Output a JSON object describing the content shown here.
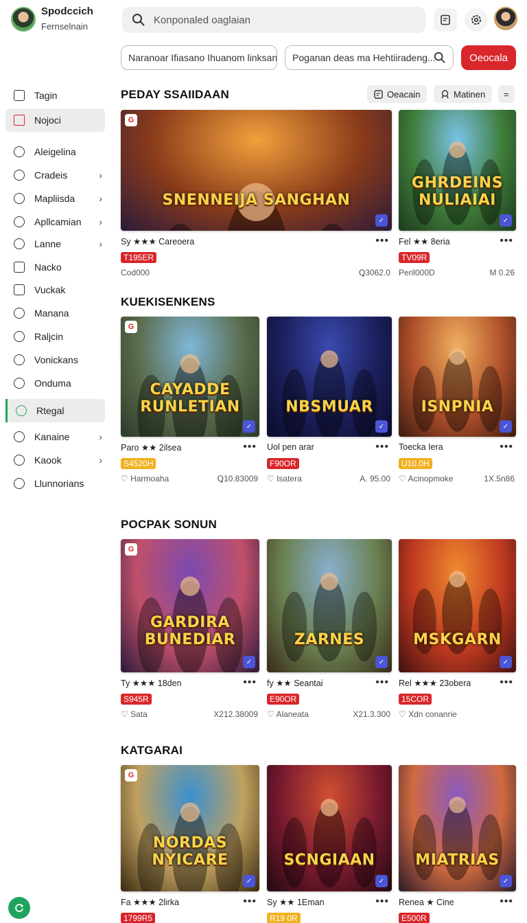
{
  "header": {
    "profile_name": "Spodccich",
    "profile_sub": "Fernselnain",
    "search_placeholder": "Konponaled oaglaian",
    "field1": "Naranoar Ifiasano Ihuanom linksan",
    "field2": "Poganan deas ma Hehtiiradeng...",
    "action_button": "Oeocala",
    "icons": [
      "search-icon",
      "document-icon",
      "settings-icon"
    ]
  },
  "sidebar": {
    "items": [
      {
        "label": "Tagin",
        "chevron": false
      },
      {
        "label": "Nojoci",
        "chevron": false
      },
      {
        "label": "Aleigelina",
        "chevron": false
      },
      {
        "label": "Cradeis",
        "chevron": true
      },
      {
        "label": "Mapliisda",
        "chevron": true
      },
      {
        "label": "Apllcamian",
        "chevron": true
      },
      {
        "label": "Lanne",
        "chevron": true
      },
      {
        "label": "Nacko",
        "chevron": false
      },
      {
        "label": "Vuckak",
        "chevron": false
      },
      {
        "label": "Manana",
        "chevron": false
      },
      {
        "label": "Raljcin",
        "chevron": false
      },
      {
        "label": "Vonickans",
        "chevron": false
      },
      {
        "label": "Onduma",
        "chevron": false
      },
      {
        "label": "Rtegal",
        "chevron": false
      },
      {
        "label": "Kanaine",
        "chevron": true
      },
      {
        "label": "Kaook",
        "chevron": true
      },
      {
        "label": "Llunnorians",
        "chevron": false
      }
    ],
    "active_item": "Nojoci",
    "selected_item": "Rtegal",
    "accent_color": "#1fa35c"
  },
  "sections": [
    {
      "title": "PEDAY SSAIIDAAN",
      "pills": [
        "Oeacain",
        "Matinen",
        "="
      ],
      "cards": [
        {
          "game_title": "SNENNEIJA SANGHAN",
          "meta": "Sy ★★★ Careoera",
          "price": "T195ER",
          "price_color": "red",
          "sub_left": "Cod000",
          "sub_right": "Ꝗ3062.0"
        },
        {
          "game_title": "GHRDEINS NULIAIAI",
          "meta": "Fel ★★ 8eria",
          "price": "TV09R",
          "price_color": "red",
          "sub_left": "Peril000D",
          "sub_right": "M 0.26"
        }
      ]
    },
    {
      "title": "KUEKISENKENS",
      "cards": [
        {
          "game_title": "CAYADDE RUNLETIAN",
          "meta": "Paro ★★ 2ilsea",
          "price": "S4520H",
          "price_color": "yellow",
          "sub_left": "Harmoaha",
          "sub_right": "Ꝗ10.83009"
        },
        {
          "game_title": "NBSMUAR",
          "meta": "Uol pen arar",
          "price": "F90OR",
          "price_color": "red",
          "sub_left": "Isatera",
          "sub_right": "A. 95.00"
        },
        {
          "game_title": "ISNPNIA",
          "meta": "Toecka Iera",
          "price": "U10.0H",
          "price_color": "yellow",
          "sub_left": "Acinopmoke",
          "sub_right": "1X.5n86"
        }
      ]
    },
    {
      "title": "POCPAK SONUN",
      "cards": [
        {
          "game_title": "GARDIRA BUNEDIAR",
          "meta": "Ty ★★★ 18den",
          "price": "S945R",
          "price_color": "red",
          "sub_left": "Sata",
          "sub_right": "X212.38009"
        },
        {
          "game_title": "ZARNES",
          "meta": "fy ★★ Seantai",
          "price": "E90OR",
          "price_color": "red",
          "sub_left": "Alaneata",
          "sub_right": "X21.3.300"
        },
        {
          "game_title": "MSKGARN",
          "meta": "Rel ★★★ 23obera",
          "price": "15COR",
          "price_color": "red",
          "sub_left": "Xdn conanrie",
          "sub_right": ""
        }
      ]
    },
    {
      "title": "KATGARAI",
      "cards": [
        {
          "game_title": "NORDAS NYICARE",
          "meta": "Fa ★★★ 2lirka",
          "price": "1799R5",
          "price_color": "red"
        },
        {
          "game_title": "SCNGIAAN",
          "meta": "Sy ★★ 1Eman",
          "price": "R19 0R",
          "price_color": "yellow"
        },
        {
          "game_title": "MIATRIAS",
          "meta": "Renea ★ Cine",
          "price": "E500R",
          "price_color": "red"
        }
      ]
    }
  ]
}
